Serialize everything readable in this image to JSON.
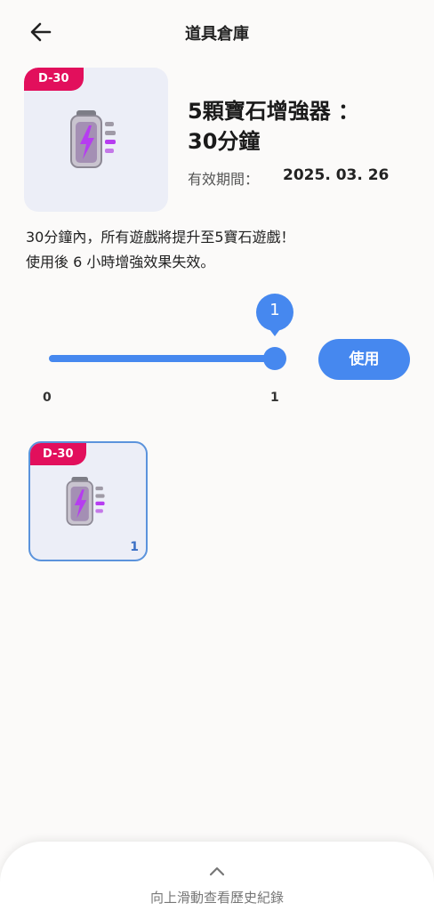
{
  "header": {
    "title": "道具倉庫",
    "back_icon": "arrow-left-icon"
  },
  "item": {
    "badge": "D-30",
    "icon": "battery-boost-icon",
    "name_line1": "5顆寶石增強器 ：",
    "name_line2": "30分鐘",
    "validity_label": "有效期間：",
    "validity_value": "2025. 03. 26"
  },
  "description": {
    "line1": "30分鐘內，所有遊戲將提升至5寶石遊戲！",
    "line2": "使用後 6 小時增強效果失效。"
  },
  "slider": {
    "current": "1",
    "min": "0",
    "max": "1",
    "fraction": 1.0
  },
  "use_button": {
    "label": "使用"
  },
  "inventory": [
    {
      "badge": "D-30",
      "count": "1",
      "selected": true
    }
  ],
  "bottom_sheet": {
    "icon": "chevron-up-icon",
    "label": "向上滑動查看歷史紀錄"
  },
  "colors": {
    "accent": "#4688ef",
    "badge": "#e20f5c",
    "battery_accent": "#b63df0"
  }
}
